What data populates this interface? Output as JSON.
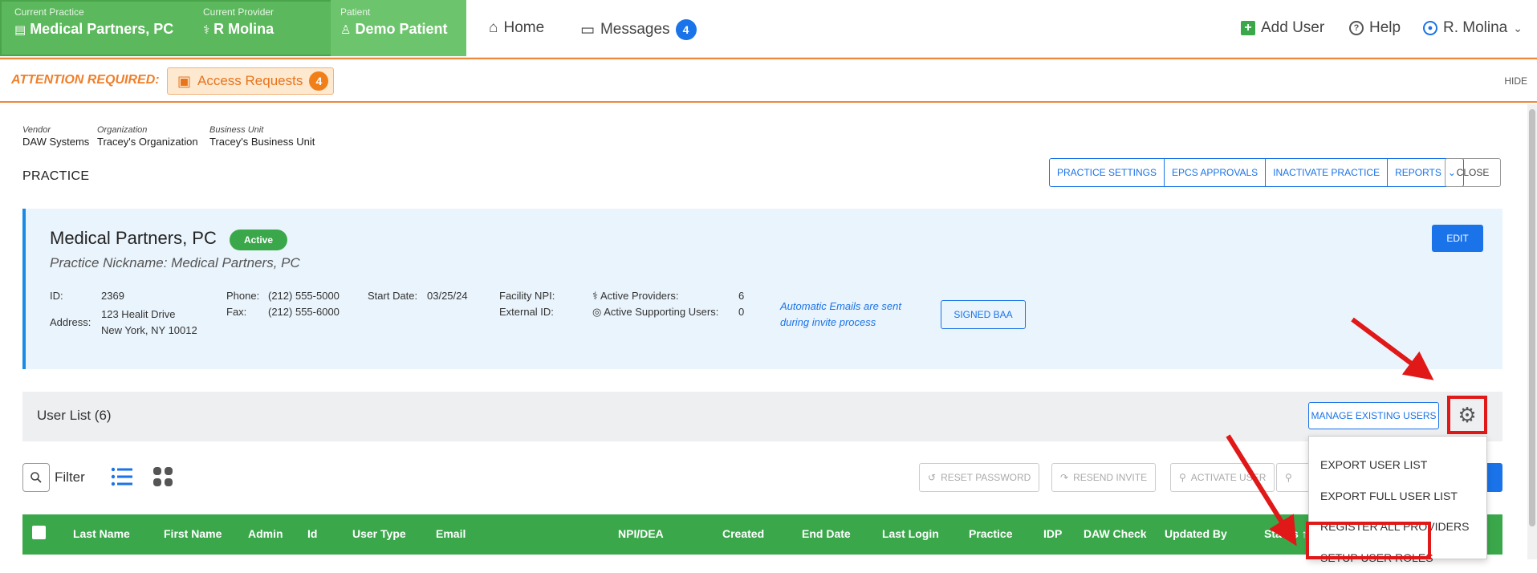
{
  "topbar": {
    "practice_label": "Current Practice",
    "practice_value": "Medical Partners, PC",
    "provider_label": "Current Provider",
    "provider_value": "R Molina",
    "patient_label": "Patient",
    "patient_value": "Demo Patient",
    "nav": {
      "home": "Home",
      "messages": "Messages",
      "messages_count": "4"
    },
    "right": {
      "add_user": "Add User",
      "help": "Help",
      "user": "R. Molina"
    }
  },
  "attention": {
    "label": "ATTENTION REQUIRED:",
    "access_requests": "Access Requests",
    "access_count": "4",
    "hide": "HIDE"
  },
  "breadcrumb": {
    "vendor_label": "Vendor",
    "vendor": "DAW Systems",
    "org_label": "Organization",
    "org": "Tracey's Organization",
    "bu_label": "Business Unit",
    "bu": "Tracey's Business Unit"
  },
  "page": {
    "title": "PRACTICE",
    "buttons": [
      "PRACTICE SETTINGS",
      "EPCS APPROVALS",
      "INACTIVATE PRACTICE",
      "REPORTS"
    ],
    "close": "CLOSE"
  },
  "practice": {
    "name": "Medical Partners, PC",
    "status": "Active",
    "nickname": "Practice Nickname: Medical Partners, PC",
    "edit": "EDIT",
    "id_label": "ID:",
    "id": "2369",
    "address_label": "Address:",
    "address_line1": "123 Healit Drive",
    "address_line2": "New York, NY 10012",
    "phone_label": "Phone:",
    "phone": "(212) 555-5000",
    "fax_label": "Fax:",
    "fax": "(212) 555-6000",
    "start_label": "Start Date:",
    "start": "03/25/24",
    "npi_label": "Facility NPI:",
    "ext_label": "External ID:",
    "providers_label": "Active Providers:",
    "providers": "6",
    "support_label": "Active Supporting Users:",
    "support": "0",
    "auto_email": "Automatic Emails are sent during invite process",
    "baa": "SIGNED BAA"
  },
  "user_list": {
    "title": "User List (6)",
    "manage": "MANAGE EXISTING USERS",
    "filter": "Filter",
    "actions": [
      "RESET PASSWORD",
      "RESEND INVITE",
      "ACTIVATE USER"
    ],
    "menu": [
      "EXPORT USER LIST",
      "EXPORT FULL USER LIST",
      "REGISTER ALL PROVIDERS",
      "SETUP USER ROLES"
    ],
    "columns": [
      "Last Name",
      "First Name",
      "Admin",
      "Id",
      "User Type",
      "Email",
      "NPI/DEA",
      "Created",
      "End Date",
      "Last Login",
      "Practice",
      "IDP",
      "DAW Check",
      "Updated By",
      "Status ↑"
    ]
  },
  "colors": {
    "brand_green": "#3aa84a",
    "accent_blue": "#1a73e8",
    "attention_orange": "#f07f2a",
    "highlight_red": "#e01818"
  }
}
